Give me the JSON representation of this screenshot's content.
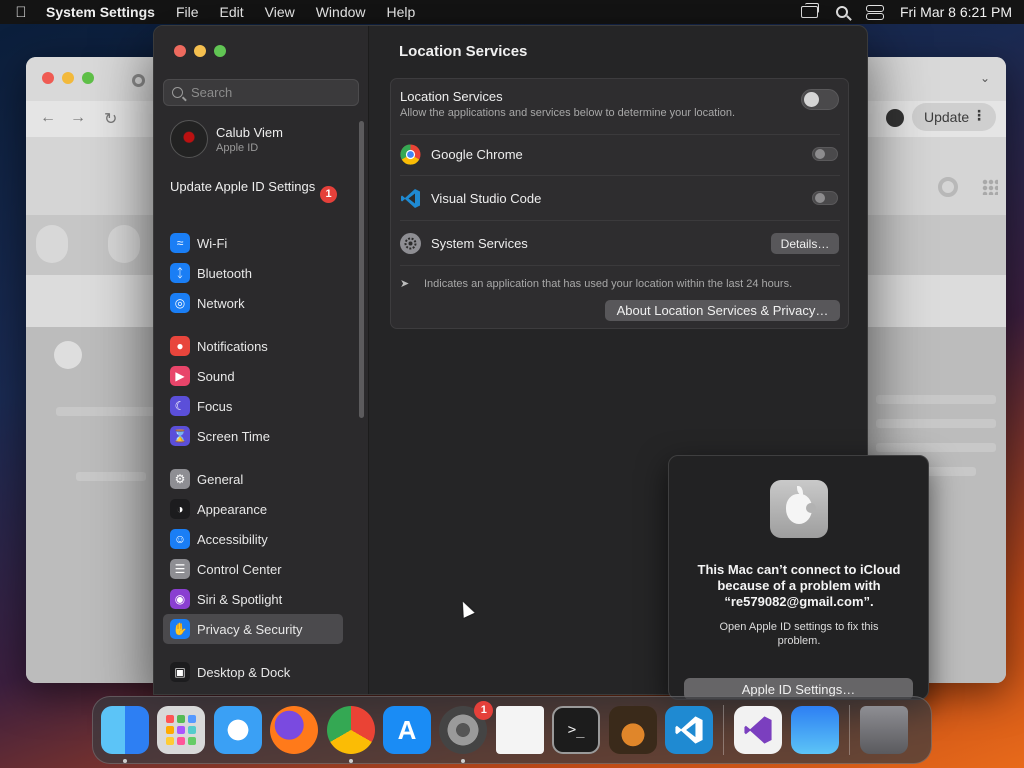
{
  "menubar": {
    "apple_icon": "apple-logo-icon",
    "app_name": "System Settings",
    "menus": [
      "File",
      "Edit",
      "View",
      "Window",
      "Help"
    ],
    "clock": "Fri Mar 8  6:21 PM",
    "status_icons": [
      "screen-mirroring-icon",
      "spotlight-search-icon",
      "control-center-icon"
    ]
  },
  "chrome_window": {
    "update_label": "Update",
    "tab_favicon": "chrome-icon"
  },
  "settings": {
    "search_placeholder": "Search",
    "account": {
      "name": "Calub Viem",
      "subtitle": "Apple ID"
    },
    "update_apple_id": "Update Apple ID Settings",
    "update_badge": "1",
    "sidebar_groups": [
      [
        {
          "label": "Wi-Fi",
          "icon": "wifi-icon",
          "color": "#1a7ef5"
        },
        {
          "label": "Bluetooth",
          "icon": "bluetooth-icon",
          "color": "#1a7ef5"
        },
        {
          "label": "Network",
          "icon": "globe-icon",
          "color": "#1a7ef5"
        }
      ],
      [
        {
          "label": "Notifications",
          "icon": "bell-icon",
          "color": "#e8453c"
        },
        {
          "label": "Sound",
          "icon": "speaker-icon",
          "color": "#e8456a"
        },
        {
          "label": "Focus",
          "icon": "moon-icon",
          "color": "#5b4fd9"
        },
        {
          "label": "Screen Time",
          "icon": "hourglass-icon",
          "color": "#5b4fd9"
        }
      ],
      [
        {
          "label": "General",
          "icon": "gear-icon",
          "color": "#8e8e93"
        },
        {
          "label": "Appearance",
          "icon": "appearance-icon",
          "color": "#1c1c1e"
        },
        {
          "label": "Accessibility",
          "icon": "accessibility-icon",
          "color": "#1a7ef5"
        },
        {
          "label": "Control Center",
          "icon": "control-center-icon",
          "color": "#8e8e93"
        },
        {
          "label": "Siri & Spotlight",
          "icon": "siri-icon",
          "color": "#8a3fd1"
        },
        {
          "label": "Privacy & Security",
          "icon": "hand-icon",
          "color": "#1a7ef5"
        }
      ],
      [
        {
          "label": "Desktop & Dock",
          "icon": "dock-icon",
          "color": "#1c1c1e"
        }
      ]
    ],
    "selected_item": "Privacy & Security",
    "page_title": "Location Services",
    "location_services": {
      "title": "Location Services",
      "subtitle": "Allow the applications and services below to determine your location.",
      "enabled": false
    },
    "apps": [
      {
        "name": "Google Chrome",
        "icon": "chrome-icon",
        "enabled": false
      },
      {
        "name": "Visual Studio Code",
        "icon": "vscode-icon",
        "enabled": false
      }
    ],
    "system_services": {
      "name": "System Services",
      "icon": "system-services-icon",
      "details_label": "Details…"
    },
    "note": "Indicates an application that has used your location within the last 24 hours.",
    "about_label": "About Location Services & Privacy…"
  },
  "alert": {
    "title": "This Mac can’t connect to iCloud because of a problem with “re579082@gmail.com”.",
    "message": "Open Apple ID settings to fix this problem.",
    "button": "Apple ID Settings…"
  },
  "dock": {
    "apps": [
      {
        "name": "Finder",
        "icon": "finder-icon",
        "running": true
      },
      {
        "name": "Launchpad",
        "icon": "launchpad-icon",
        "running": false
      },
      {
        "name": "Safari",
        "icon": "safari-icon",
        "running": false
      },
      {
        "name": "Firefox",
        "icon": "firefox-icon",
        "running": false
      },
      {
        "name": "Google Chrome",
        "icon": "chrome-icon",
        "running": true
      },
      {
        "name": "App Store",
        "icon": "app-store-icon",
        "running": false
      },
      {
        "name": "System Settings",
        "icon": "system-settings-icon",
        "running": true,
        "badge": "1"
      },
      {
        "name": "TextEdit",
        "icon": "textedit-icon",
        "running": false
      },
      {
        "name": "Terminal",
        "icon": "terminal-icon",
        "running": false
      },
      {
        "name": "GarageBand",
        "icon": "garageband-icon",
        "running": false
      },
      {
        "name": "Visual Studio Code",
        "icon": "vscode-icon",
        "running": false
      },
      {
        "name": "Visual Studio",
        "icon": "visual-studio-icon",
        "running": false
      },
      {
        "name": "Weather",
        "icon": "weather-icon",
        "running": false
      },
      {
        "name": "Trash",
        "icon": "trash-icon",
        "running": false
      }
    ]
  }
}
